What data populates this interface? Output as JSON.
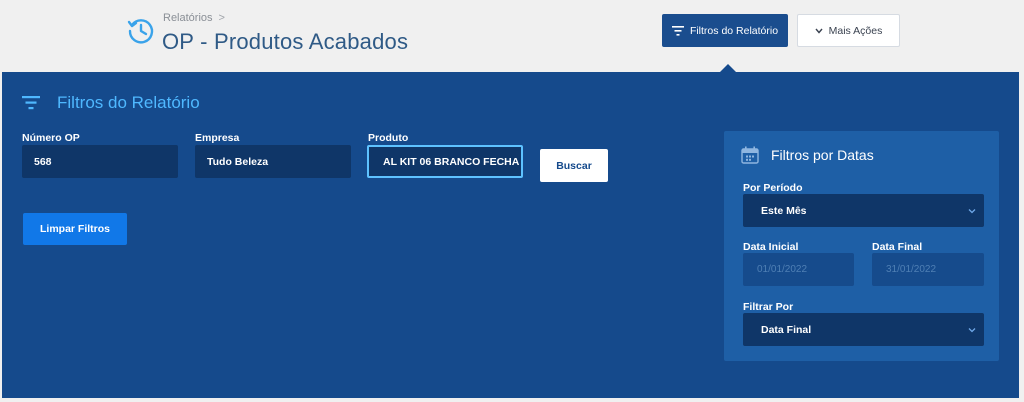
{
  "header": {
    "breadcrumb": "Relatórios",
    "breadcrumb_sep": ">",
    "title": "OP - Produtos Acabados",
    "filters_button": "Filtros do Relatório",
    "more_button": "Mais Ações"
  },
  "panel": {
    "title": "Filtros do Relatório",
    "fields": {
      "numero_op": {
        "label": "Número OP",
        "value": "568"
      },
      "empresa": {
        "label": "Empresa",
        "value": "Tudo Beleza"
      },
      "produto": {
        "label": "Produto",
        "value": "AL KIT 06 BRANCO FECHA"
      }
    },
    "search_button": "Buscar",
    "clear_button": "Limpar Filtros"
  },
  "date_filters": {
    "title": "Filtros por Datas",
    "periodo": {
      "label": "Por Período",
      "value": "Este Mês"
    },
    "data_inicial": {
      "label": "Data Inicial",
      "placeholder": "01/01/2022"
    },
    "data_final": {
      "label": "Data Final",
      "placeholder": "31/01/2022"
    },
    "filtrar_por": {
      "label": "Filtrar Por",
      "value": "Data Final"
    }
  },
  "colors": {
    "panel": "#154a8c",
    "title_accent": "#4fb8ff",
    "input_bg": "#0f3668",
    "primary_button": "#1178e8"
  },
  "icons": {
    "report": "clock-report-icon",
    "filter": "filter-icon",
    "calendar": "calendar-icon",
    "chevron": "chevron-down-icon"
  }
}
